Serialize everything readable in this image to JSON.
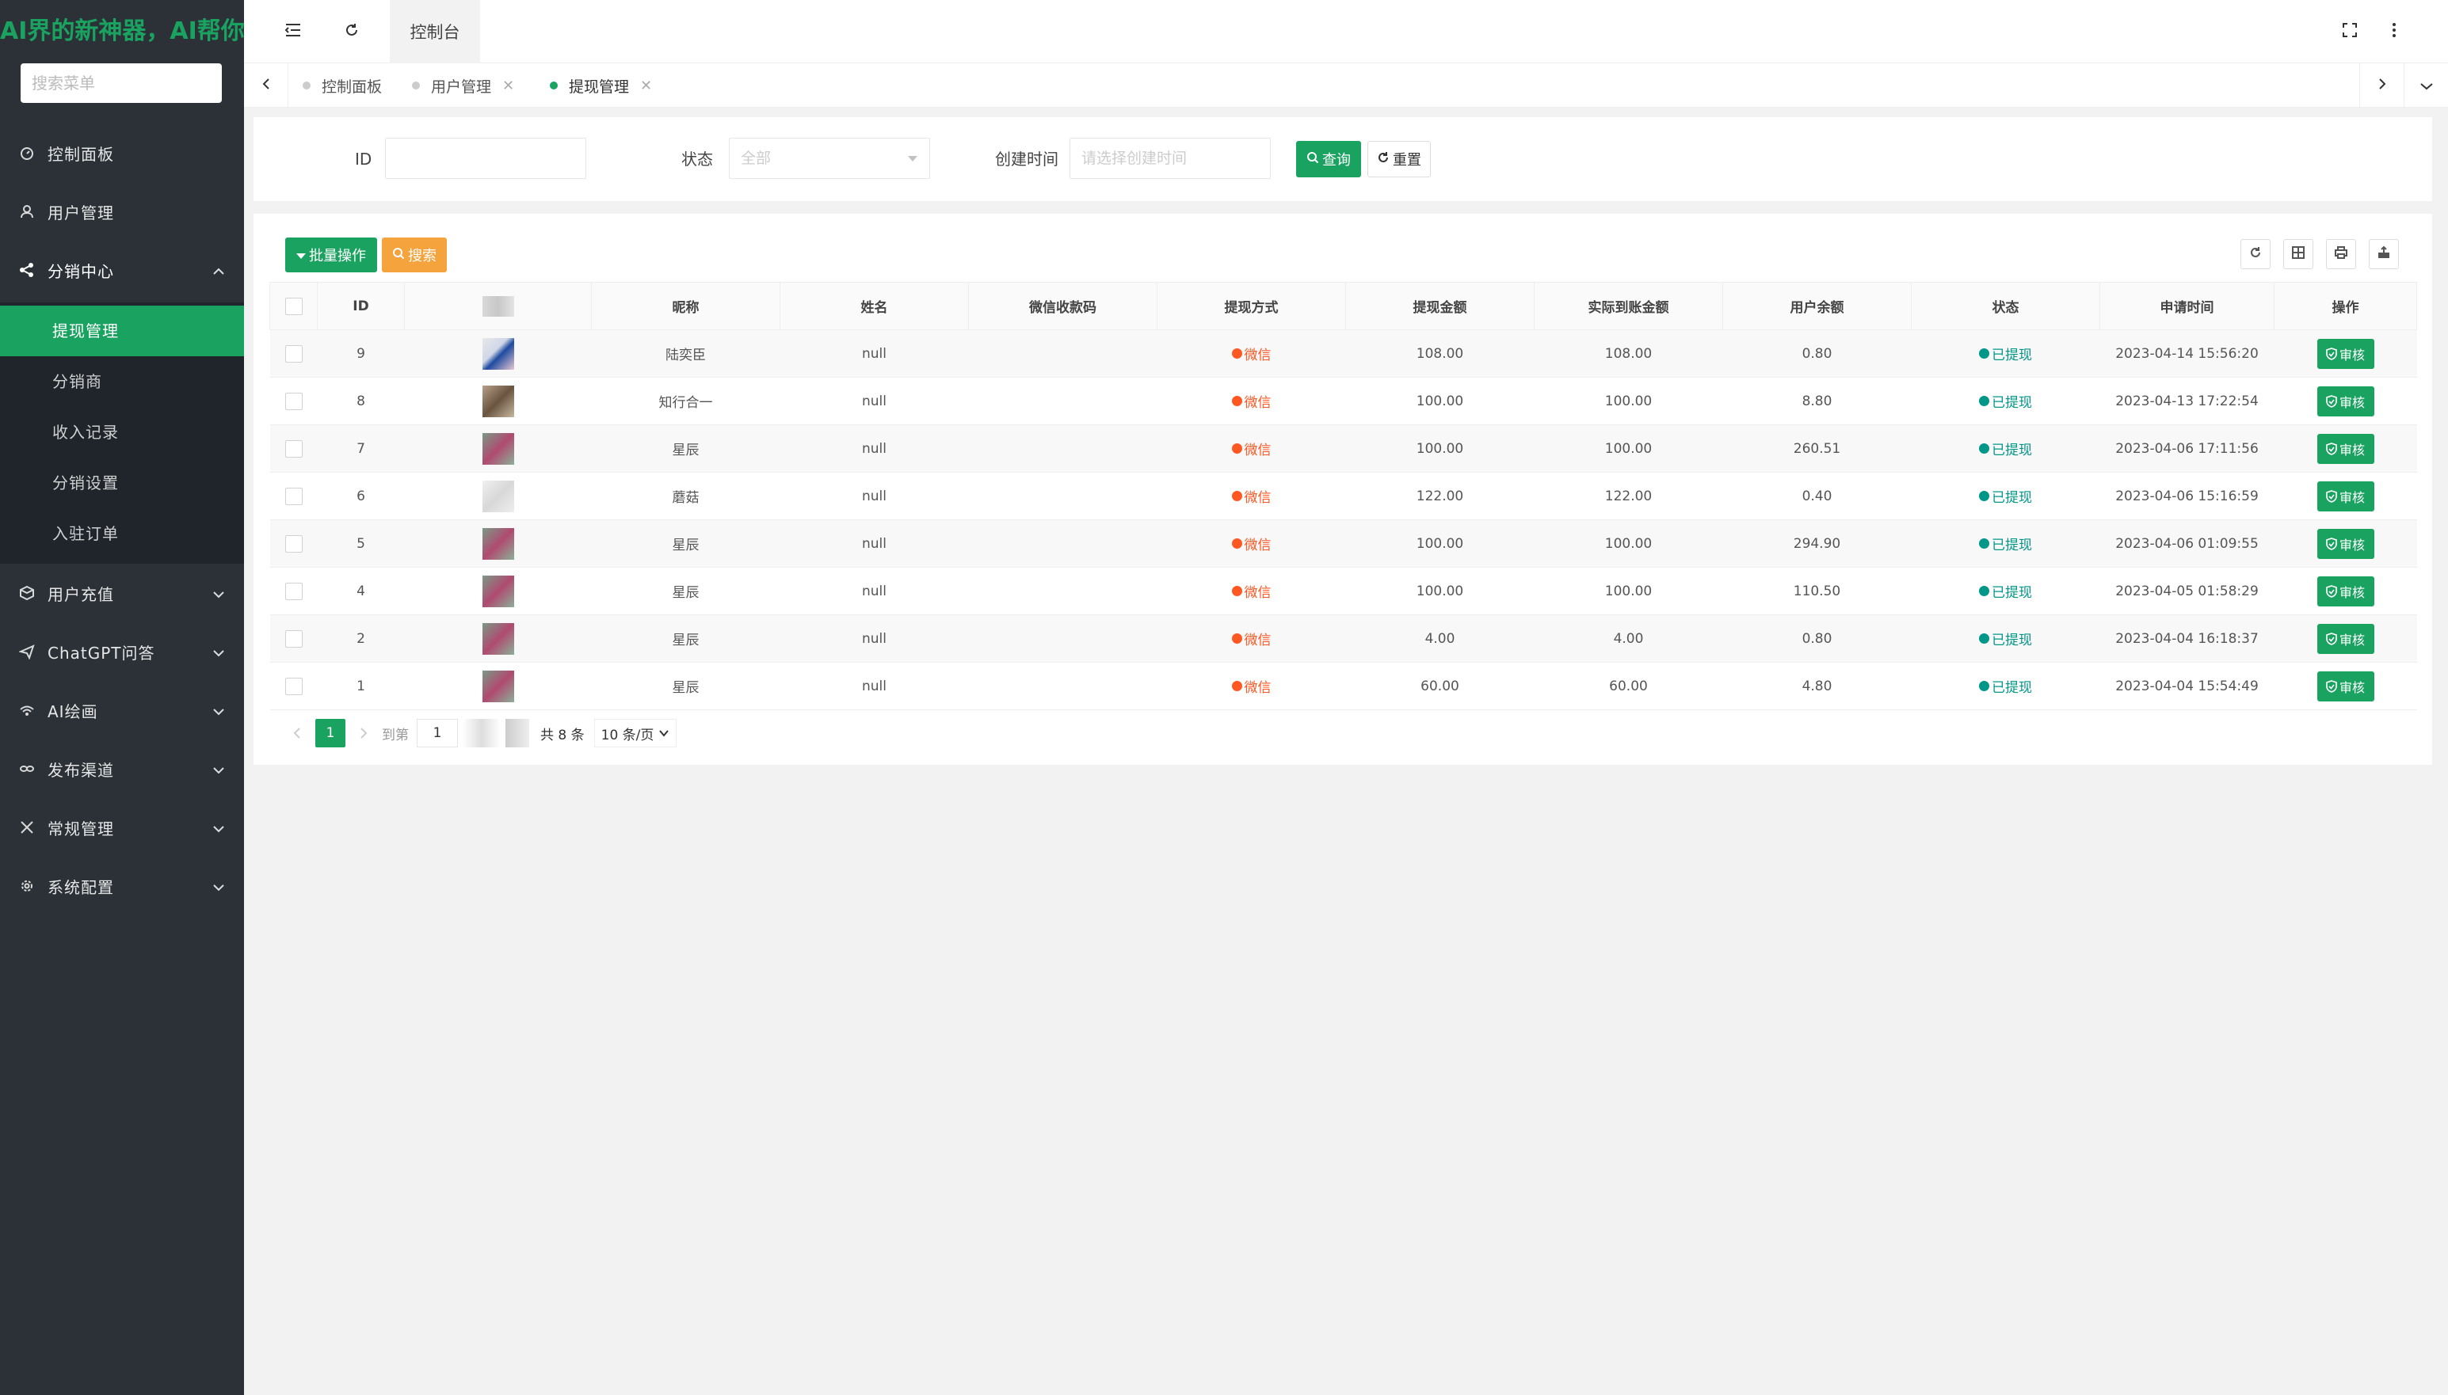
{
  "sidebar": {
    "logo": "AI界的新神器，AI帮你",
    "search_placeholder": "搜索菜单",
    "items": [
      {
        "label": "控制面板"
      },
      {
        "label": "用户管理"
      },
      {
        "label": "分销中心"
      },
      {
        "label": "用户充值"
      },
      {
        "label": "ChatGPT问答"
      },
      {
        "label": "AI绘画"
      },
      {
        "label": "发布渠道"
      },
      {
        "label": "常规管理"
      },
      {
        "label": "系统配置"
      }
    ],
    "sub_items": [
      {
        "label": "提现管理"
      },
      {
        "label": "分销商"
      },
      {
        "label": "收入记录"
      },
      {
        "label": "分销设置"
      },
      {
        "label": "入驻订单"
      }
    ]
  },
  "topbar": {
    "console_tab": "控制台"
  },
  "page_tabs": [
    {
      "label": "控制面板"
    },
    {
      "label": "用户管理"
    },
    {
      "label": "提现管理"
    }
  ],
  "filter": {
    "id_label": "ID",
    "status_label": "状态",
    "status_value": "全部",
    "time_label": "创建时间",
    "time_placeholder": "请选择创建时间",
    "query_button": "查询",
    "reset_button": "重置"
  },
  "toolbar": {
    "batch_button": "批量操作",
    "search_button": "搜索"
  },
  "table": {
    "headers": [
      "ID",
      "",
      "昵称",
      "姓名",
      "微信收款码",
      "提现方式",
      "提现金额",
      "实际到账金额",
      "用户余额",
      "状态",
      "申请时间",
      "操作"
    ],
    "method_label": "微信",
    "status_label": "已提现",
    "action_label": "审核",
    "rows": [
      {
        "id": "9",
        "nickname": "陆奕臣",
        "name": "null",
        "amount": "108.00",
        "actual": "108.00",
        "balance": "0.80",
        "time": "2023-04-14 15:56:20"
      },
      {
        "id": "8",
        "nickname": "知行合一",
        "name": "null",
        "amount": "100.00",
        "actual": "100.00",
        "balance": "8.80",
        "time": "2023-04-13 17:22:54"
      },
      {
        "id": "7",
        "nickname": "星辰",
        "name": "null",
        "amount": "100.00",
        "actual": "100.00",
        "balance": "260.51",
        "time": "2023-04-06 17:11:56"
      },
      {
        "id": "6",
        "nickname": "蘑菇",
        "name": "null",
        "amount": "122.00",
        "actual": "122.00",
        "balance": "0.40",
        "time": "2023-04-06 15:16:59"
      },
      {
        "id": "5",
        "nickname": "星辰",
        "name": "null",
        "amount": "100.00",
        "actual": "100.00",
        "balance": "294.90",
        "time": "2023-04-06 01:09:55"
      },
      {
        "id": "4",
        "nickname": "星辰",
        "name": "null",
        "amount": "100.00",
        "actual": "100.00",
        "balance": "110.50",
        "time": "2023-04-05 01:58:29"
      },
      {
        "id": "2",
        "nickname": "星辰",
        "name": "null",
        "amount": "4.00",
        "actual": "4.00",
        "balance": "0.80",
        "time": "2023-04-04 16:18:37"
      },
      {
        "id": "1",
        "nickname": "星辰",
        "name": "null",
        "amount": "60.00",
        "actual": "60.00",
        "balance": "4.80",
        "time": "2023-04-04 15:54:49"
      }
    ]
  },
  "pager": {
    "current": "1",
    "goto_label": "到第",
    "goto_value": "1",
    "total": "共 8 条",
    "page_size": "10 条/页"
  },
  "colors": {
    "primary": "#1aa260",
    "warning": "#f5a33c",
    "wechat": "#ff5722",
    "status": "#009688",
    "sidebar": "#2b3137"
  }
}
